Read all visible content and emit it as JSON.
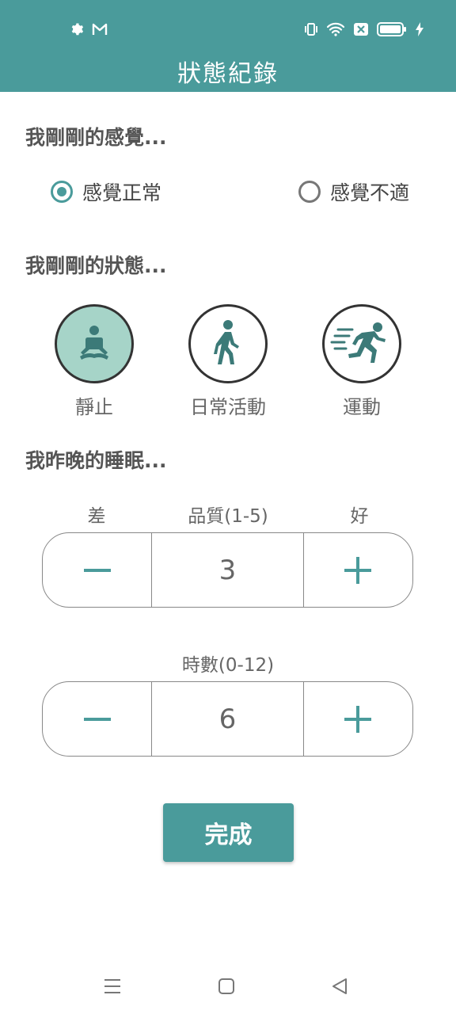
{
  "app": {
    "title": "狀態紀錄",
    "accent": "#4a9b9b"
  },
  "status_bar": {
    "left_icons": [
      "gear-icon",
      "gmail-icon"
    ],
    "right_icons": [
      "vibrate-icon",
      "wifi-icon",
      "notification-x-icon",
      "battery-icon",
      "charging-icon"
    ]
  },
  "feeling": {
    "label": "我剛剛的感覺...",
    "options": [
      {
        "label": "感覺正常",
        "selected": true
      },
      {
        "label": "感覺不適",
        "selected": false
      }
    ]
  },
  "state": {
    "label": "我剛剛的狀態...",
    "options": [
      {
        "label": "靜止",
        "icon": "meditation-icon",
        "selected": true
      },
      {
        "label": "日常活動",
        "icon": "walking-icon",
        "selected": false
      },
      {
        "label": "運動",
        "icon": "running-icon",
        "selected": false
      }
    ]
  },
  "sleep": {
    "label": "我昨晚的睡眠...",
    "quality": {
      "label": "品質(1-5)",
      "low": "差",
      "high": "好",
      "value": "3"
    },
    "hours": {
      "label": "時數(0-12)",
      "value": "6"
    }
  },
  "done_label": "完成",
  "nav": [
    "menu-icon",
    "home-icon",
    "back-icon"
  ]
}
